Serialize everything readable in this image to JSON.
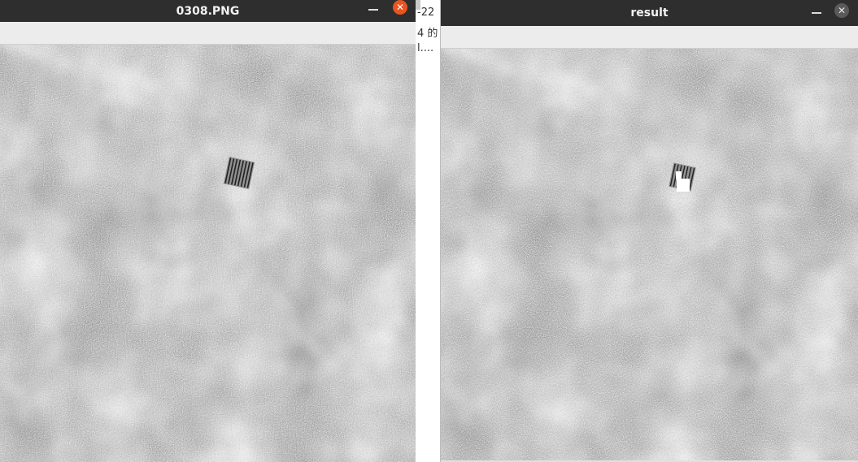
{
  "windows": {
    "left": {
      "title": "0308.PNG",
      "close_label": "✕"
    },
    "right": {
      "title": "result",
      "close_label": "✕"
    }
  },
  "background_text": {
    "line1": "-22",
    "line2": "4 的",
    "line3": "l...."
  },
  "icons": {
    "minimize": "minimize-icon",
    "close": "close-icon"
  },
  "colors": {
    "titlebar": "#2e2e2e",
    "close_active": "#e95420",
    "close_inactive": "#5a5a5a"
  }
}
